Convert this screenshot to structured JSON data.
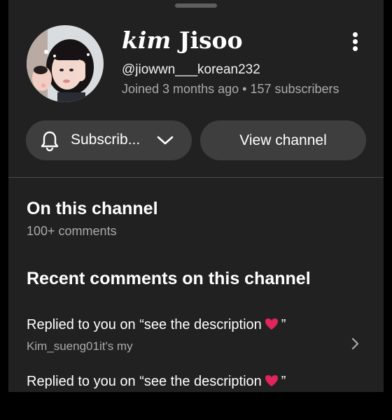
{
  "channel": {
    "name_prefix": "kim",
    "name_main": "Jisoo",
    "handle": "@jiowwn___korean232",
    "joined": "Joined 3 months ago",
    "separator": "•",
    "subscribers": "157 subscribers"
  },
  "actions": {
    "subscribe_label": "Subscrib...",
    "view_channel_label": "View channel"
  },
  "section": {
    "title": "On this channel",
    "comment_count": "100+ comments"
  },
  "recent": {
    "title": "Recent comments on this channel",
    "items": [
      {
        "prefix": "Replied to you on “see the description",
        "suffix": "”",
        "emoji": "heart-icon",
        "subtitle": "Kim_sueng01it's my"
      },
      {
        "prefix": "Replied to you on “see the description",
        "suffix": "”",
        "emoji": "heart-icon",
        "subtitle": ""
      }
    ]
  },
  "colors": {
    "sheet_bg": "#212121",
    "pill_bg": "#3e3e3e",
    "secondary_text": "#aaaaaa",
    "heart": "#e0245e"
  },
  "icons": {
    "bell": "bell-icon",
    "dropdown": "chevron-down-icon",
    "more": "more-vert-icon",
    "row_arrow": "chevron-right-icon"
  }
}
